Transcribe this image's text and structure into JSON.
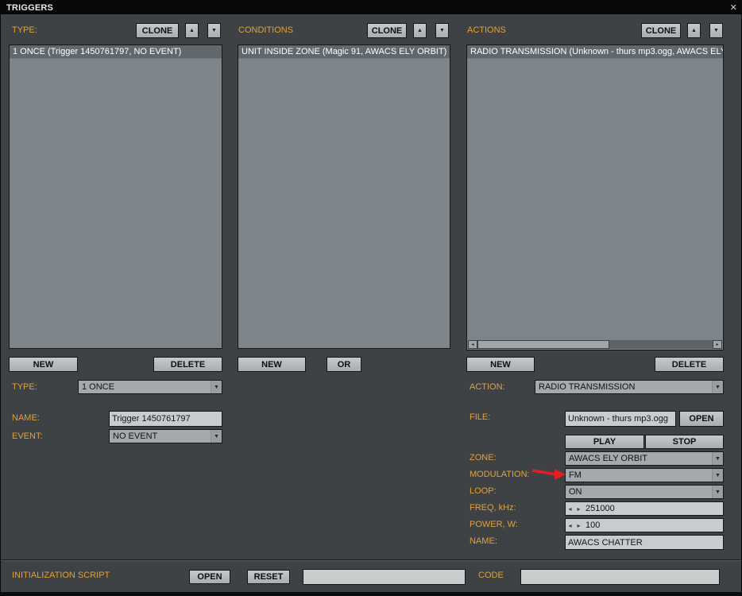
{
  "window": {
    "title": "TRIGGERS"
  },
  "icons": {
    "close": "✕",
    "up": "▲",
    "down": "▼",
    "dropdown": "▼",
    "left": "◂",
    "right": "▸"
  },
  "colors": {
    "accent_orange": "#dfa23d",
    "annotation_red": "#e02020",
    "panel_bg": "#3e4245",
    "list_bg": "#7e858a",
    "selected_row": "#61686d"
  },
  "type_panel": {
    "header_label": "TYPE:",
    "clone_label": "CLONE",
    "items": [
      "1 ONCE (Trigger 1450761797, NO EVENT)"
    ],
    "new_label": "NEW",
    "delete_label": "DELETE",
    "type_label": "TYPE:",
    "type_value": "1 ONCE",
    "name_label": "NAME:",
    "name_value": "Trigger 1450761797",
    "event_label": "EVENT:",
    "event_value": "NO EVENT"
  },
  "conditions_panel": {
    "header_label": "CONDITIONS",
    "clone_label": "CLONE",
    "items": [
      "UNIT INSIDE ZONE (Magic 91, AWACS ELY ORBIT)"
    ],
    "new_label": "NEW",
    "or_label": "OR"
  },
  "actions_panel": {
    "header_label": "ACTIONS",
    "clone_label": "CLONE",
    "items": [
      "RADIO TRANSMISSION (Unknown - thurs mp3.ogg, AWACS ELY"
    ],
    "new_label": "NEW",
    "delete_label": "DELETE",
    "action_label": "ACTION:",
    "action_value": "RADIO TRANSMISSION",
    "file_label": "FILE:",
    "file_value": "Unknown - thurs mp3.ogg",
    "open_label": "OPEN",
    "play_label": "PLAY",
    "stop_label": "STOP",
    "zone_label": "ZONE:",
    "zone_value": "AWACS ELY ORBIT",
    "modulation_label": "MODULATION:",
    "modulation_value": "FM",
    "loop_label": "LOOP:",
    "loop_value": "ON",
    "freq_label": "FREQ, kHz:",
    "freq_value": "251000",
    "power_label": "POWER, W:",
    "power_value": "100",
    "name_label": "NAME:",
    "name_value": "AWACS CHATTER"
  },
  "footer": {
    "init_label": "INITIALIZATION SCRIPT",
    "open_label": "OPEN",
    "reset_label": "RESET",
    "script_value": "",
    "code_label": "CODE",
    "code_value": ""
  }
}
